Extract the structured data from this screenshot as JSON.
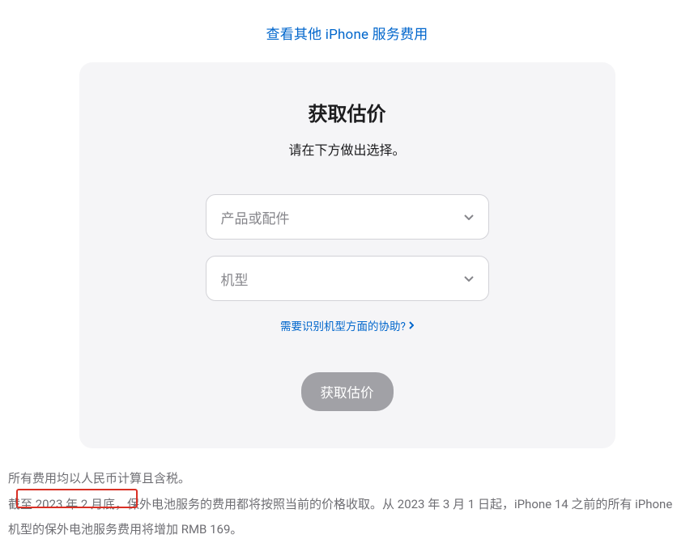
{
  "topLink": {
    "label": "查看其他 iPhone 服务费用"
  },
  "card": {
    "title": "获取估价",
    "subtitle": "请在下方做出选择。",
    "selectProduct": {
      "placeholder": "产品或配件"
    },
    "selectModel": {
      "placeholder": "机型"
    },
    "helpLink": {
      "label": "需要识别机型方面的协助?"
    },
    "ctaButton": {
      "label": "获取估价"
    }
  },
  "footer": {
    "line1": "所有费用均以人民币计算且含税。",
    "line2": "截至 2023 年 2 月底，保外电池服务的费用都将按照当前的价格收取。从 2023 年 3 月 1 日起，iPhone 14 之前的所有 iPhone 机型的保外电池服务费用将增加 RMB 169。"
  }
}
